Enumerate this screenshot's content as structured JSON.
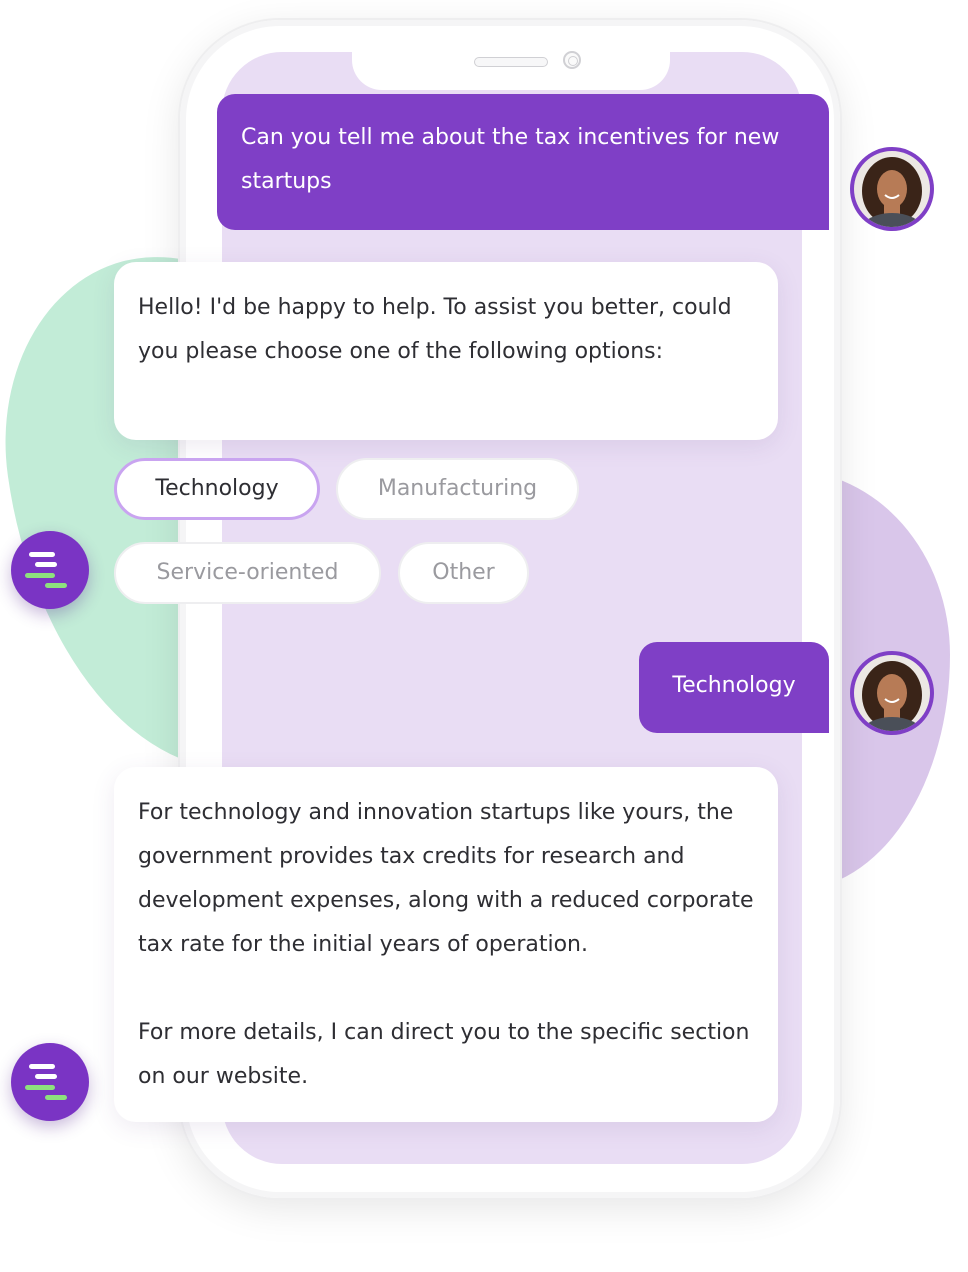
{
  "conversation": {
    "user_question": "Can you tell me about the tax incentives for new startups",
    "bot_greeting": "Hello! I'd be happy to help. To assist you better, could you please choose one of the following options:",
    "options": [
      {
        "label": "Technology",
        "selected": true
      },
      {
        "label": "Manufacturing",
        "selected": false
      },
      {
        "label": "Service-oriented",
        "selected": false
      },
      {
        "label": "Other",
        "selected": false
      }
    ],
    "user_choice": "Technology",
    "bot_answer_p1": "For technology and innovation startups like yours, the government provides tax credits for research and development expenses, along with a reduced corporate tax rate for the initial years of operation.",
    "bot_answer_p2": "For more details, I can direct you to the specific section on our website."
  },
  "icons": {
    "user_avatar": "user-avatar-photo",
    "bot_avatar": "bot-logo-icon"
  },
  "colors": {
    "accent": "#7f3fc6",
    "selected_chip_border": "#c9a4f0",
    "screen_background": "#e9ddf4",
    "logo_green": "#8de27d"
  }
}
